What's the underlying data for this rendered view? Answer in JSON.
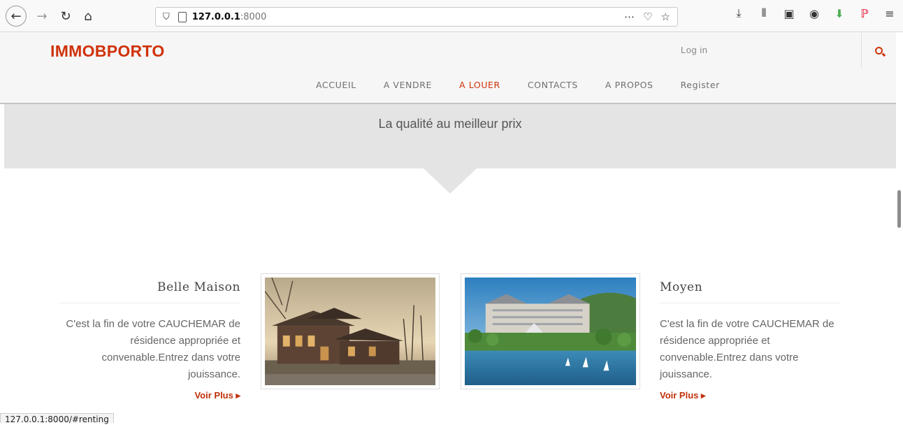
{
  "browser": {
    "url_host": "127.0.0.1",
    "url_port": ":8000",
    "status_url": "127.0.0.1:8000/#renting"
  },
  "site": {
    "logo": "IMMOBPORTO",
    "login": "Log in",
    "nav": [
      {
        "label": "ACCUEIL"
      },
      {
        "label": "A VENDRE"
      },
      {
        "label": "A LOUER"
      },
      {
        "label": "CONTACTS"
      },
      {
        "label": "A PROPOS"
      },
      {
        "label": "Register"
      }
    ],
    "tagline": "La qualité au meilleur prix"
  },
  "listings": [
    {
      "title": "Belle Maison",
      "description": "C'est la fin de votre CAUCHEMAR de résidence appropriée et convenable.Entrez dans votre jouissance.",
      "link": "Voir Plus ▸"
    },
    {
      "title": "Moyen",
      "description": "C'est la fin de votre CAUCHEMAR de résidence appropriée et convenable.Entrez dans votre jouissance.",
      "link": "Voir Plus ▸"
    }
  ],
  "colors": {
    "brand": "#d0320b",
    "nav_text": "#6f6f6f",
    "band": "#e4e4e4"
  }
}
